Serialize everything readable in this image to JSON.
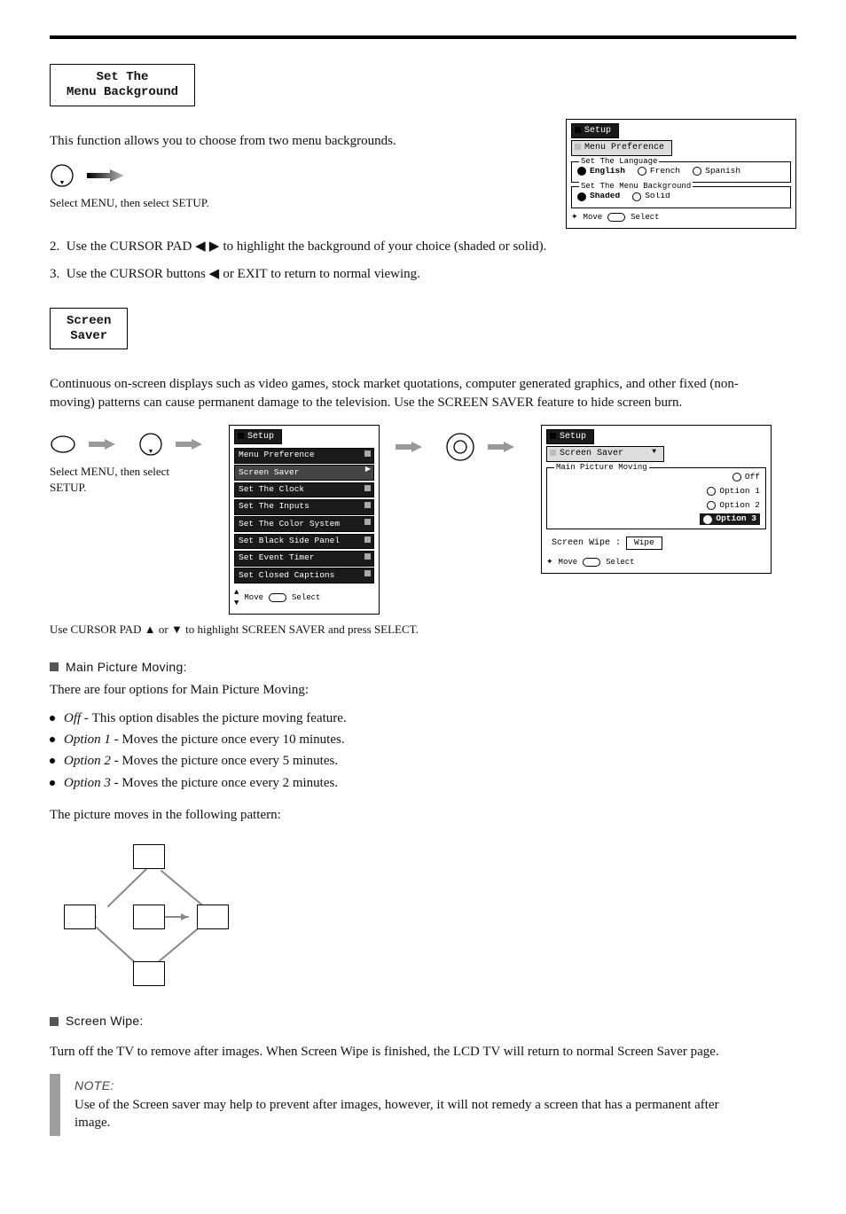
{
  "section_bg": {
    "title_line1": "Set The",
    "title_line2": "Menu Background",
    "intro": "This function allows you to choose from two menu backgrounds.",
    "caption1": "Select MENU, then select SETUP.",
    "step2_a": "Use the CURSOR PAD ",
    "step2_tri": " ◀  ▶ ",
    "step2_b": " to highlight the background of your choice (shaded or solid).",
    "step3_a": "Use the CURSOR buttons ",
    "step3_tri": " ◀ ",
    "step3_b": " or EXIT to return to normal viewing.",
    "osd": {
      "tab_setup": "Setup",
      "tab_pref": "Menu Preference",
      "lang_legend": "Set The Language",
      "lang": [
        {
          "label": "English",
          "sel": true
        },
        {
          "label": "French",
          "sel": false
        },
        {
          "label": "Spanish",
          "sel": false
        }
      ],
      "bg_legend": "Set The Menu Background",
      "bg": [
        {
          "label": "Shaded",
          "sel": true
        },
        {
          "label": "Solid",
          "sel": false
        }
      ],
      "hint_move": "Move",
      "hint_select": "Select"
    }
  },
  "section_ss": {
    "title_line1": "Screen",
    "title_line2": "Saver",
    "intro": "Continuous on-screen displays such as video games, stock market quotations, computer generated graphics, and other fixed (non-moving) patterns can cause permanent damage to the television. Use the SCREEN SAVER feature to hide screen burn.",
    "caption_left": "Select MENU, then select SETUP.",
    "caption_mid": "Use CURSOR PAD ▲ or ▼ to highlight SCREEN SAVER and press SELECT.",
    "osd_left": {
      "tab_setup": "Setup",
      "items": [
        {
          "label": "Menu Preference",
          "marker": "sq"
        },
        {
          "label": "Screen Saver",
          "marker": "ar",
          "active": true
        },
        {
          "label": "Set The Clock",
          "marker": "sq"
        },
        {
          "label": "Set The Inputs",
          "marker": "sq"
        },
        {
          "label": "Set The Color System",
          "marker": "sq"
        },
        {
          "label": "Set Black Side Panel",
          "marker": "sq"
        },
        {
          "label": "Set Event Timer",
          "marker": "sq"
        },
        {
          "label": "Set Closed Captions",
          "marker": "sq"
        }
      ],
      "hint_move": "Move",
      "hint_select": "Select"
    },
    "osd_right": {
      "tab_setup": "Setup",
      "tab_ss": "Screen Saver",
      "group_legend": "Main Picture Moving",
      "options": [
        {
          "label": "Off",
          "sel": false
        },
        {
          "label": "Option 1",
          "sel": false
        },
        {
          "label": "Option 2",
          "sel": false
        },
        {
          "label": "Option 3",
          "sel": true,
          "hl": true
        }
      ],
      "wipe_label": "Screen Wipe :",
      "wipe_button": "Wipe",
      "hint_move": "Move",
      "hint_select": "Select"
    },
    "moving_heading": "Main Picture Moving:",
    "moving_intro": "There are four options for Main Picture Moving:",
    "moving_opts": [
      {
        "name": "Off - ",
        "desc": "This option disables the picture moving feature."
      },
      {
        "name": "Option 1 - ",
        "desc": "Moves the picture once every 10 minutes."
      },
      {
        "name": "Option 2 - ",
        "desc": "Moves the picture once every 5 minutes."
      },
      {
        "name": "Option 3 - ",
        "desc": "Moves the picture once every 2 minutes."
      }
    ],
    "moving_post": "The picture moves in the following pattern:",
    "wipe_heading": "Screen Wipe:",
    "wipe_text": "Turn off the TV to remove after images. When Screen Wipe is finished, the LCD TV will return to normal Screen Saver page.",
    "note_label": "NOTE:",
    "note_text": "Use of the Screen saver may help to prevent after images, however, it will not remedy a screen that has a permanent after image."
  }
}
